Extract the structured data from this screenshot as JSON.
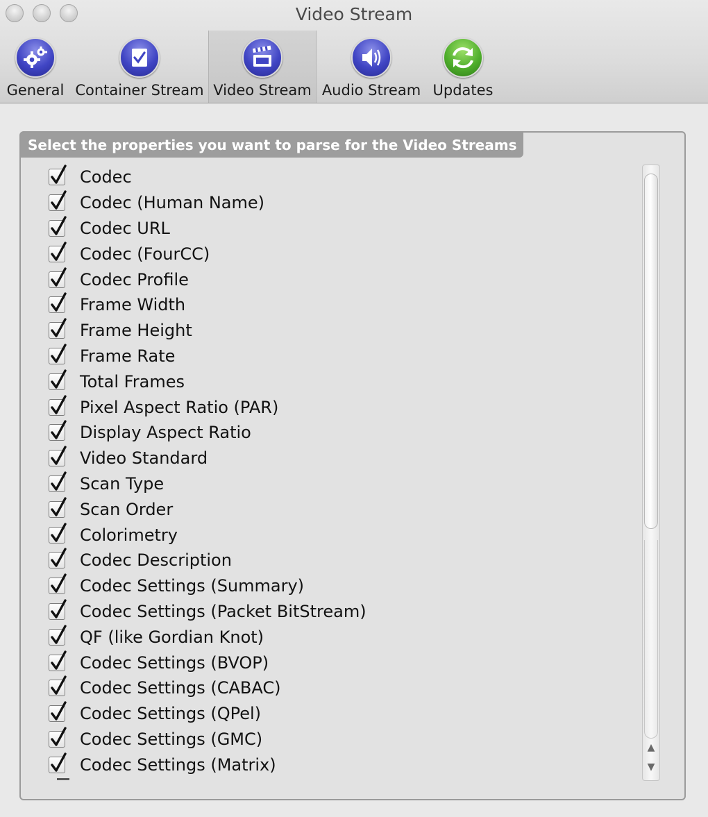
{
  "window": {
    "title": "Video Stream"
  },
  "toolbar": {
    "items": [
      {
        "label": "General",
        "icon": "gear-icon"
      },
      {
        "label": "Container Stream",
        "icon": "checkbox-doc-icon"
      },
      {
        "label": "Video Stream",
        "icon": "clapperboard-icon"
      },
      {
        "label": "Audio Stream",
        "icon": "speaker-icon"
      },
      {
        "label": "Updates",
        "icon": "refresh-icon"
      }
    ],
    "selected": "Video Stream"
  },
  "group": {
    "title": "Select the properties you want to parse for the Video Streams"
  },
  "properties": [
    {
      "label": "Codec",
      "checked": true
    },
    {
      "label": "Codec (Human Name)",
      "checked": true
    },
    {
      "label": "Codec URL",
      "checked": true
    },
    {
      "label": "Codec (FourCC)",
      "checked": true
    },
    {
      "label": "Codec Profile",
      "checked": true
    },
    {
      "label": "Frame Width",
      "checked": true
    },
    {
      "label": "Frame Height",
      "checked": true
    },
    {
      "label": "Frame Rate",
      "checked": true
    },
    {
      "label": "Total Frames",
      "checked": true
    },
    {
      "label": "Pixel Aspect Ratio (PAR)",
      "checked": true
    },
    {
      "label": "Display Aspect Ratio",
      "checked": true
    },
    {
      "label": "Video Standard",
      "checked": true
    },
    {
      "label": "Scan Type",
      "checked": true
    },
    {
      "label": "Scan Order",
      "checked": true
    },
    {
      "label": "Colorimetry",
      "checked": true
    },
    {
      "label": "Codec Description",
      "checked": true
    },
    {
      "label": "Codec Settings (Summary)",
      "checked": true
    },
    {
      "label": "Codec Settings (Packet BitStream)",
      "checked": true
    },
    {
      "label": "QF (like Gordian Knot)",
      "checked": true
    },
    {
      "label": "Codec Settings (BVOP)",
      "checked": true
    },
    {
      "label": "Codec Settings (CABAC)",
      "checked": true
    },
    {
      "label": "Codec Settings (QPel)",
      "checked": true
    },
    {
      "label": "Codec Settings (GMC)",
      "checked": true
    },
    {
      "label": "Codec Settings (Matrix)",
      "checked": true
    }
  ],
  "scrollbar": {
    "up_icon": "arrow-up-icon",
    "down_icon": "arrow-down-icon"
  },
  "colors": {
    "accent_blue": "#4045c4",
    "accent_green": "#4fae2c",
    "group_title_bg": "#9d9d9d"
  }
}
